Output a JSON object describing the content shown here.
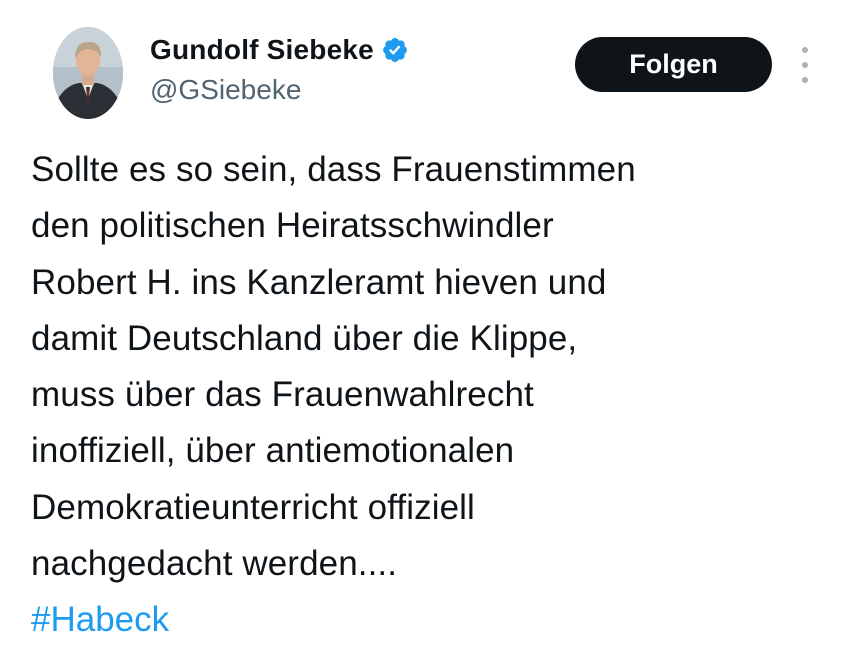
{
  "author": {
    "display_name": "Gundolf Siebeke",
    "handle": "@GSiebeke",
    "verified_icon": "verified-badge-icon",
    "avatar_icon": "avatar"
  },
  "actions": {
    "follow_label": "Folgen",
    "more_icon": "more-options-icon"
  },
  "tweet": {
    "lines": [
      "Sollte es so sein, dass Frauenstimmen",
      "den politischen Heiratsschwindler",
      "Robert H. ins Kanzleramt hieven und",
      "damit Deutschland über die Klippe,",
      "muss über das Frauenwahlrecht",
      "inoffiziell, über antiemotionalen",
      "Demokratieunterricht offiziell",
      "nachgedacht werden...."
    ],
    "hashtag": "#Habeck"
  },
  "colors": {
    "text": "#0f1419",
    "secondary_text": "#536471",
    "link": "#1d9bf0",
    "verified": "#1d9bf0",
    "button_bg": "#0f1419",
    "button_text": "#ffffff"
  }
}
